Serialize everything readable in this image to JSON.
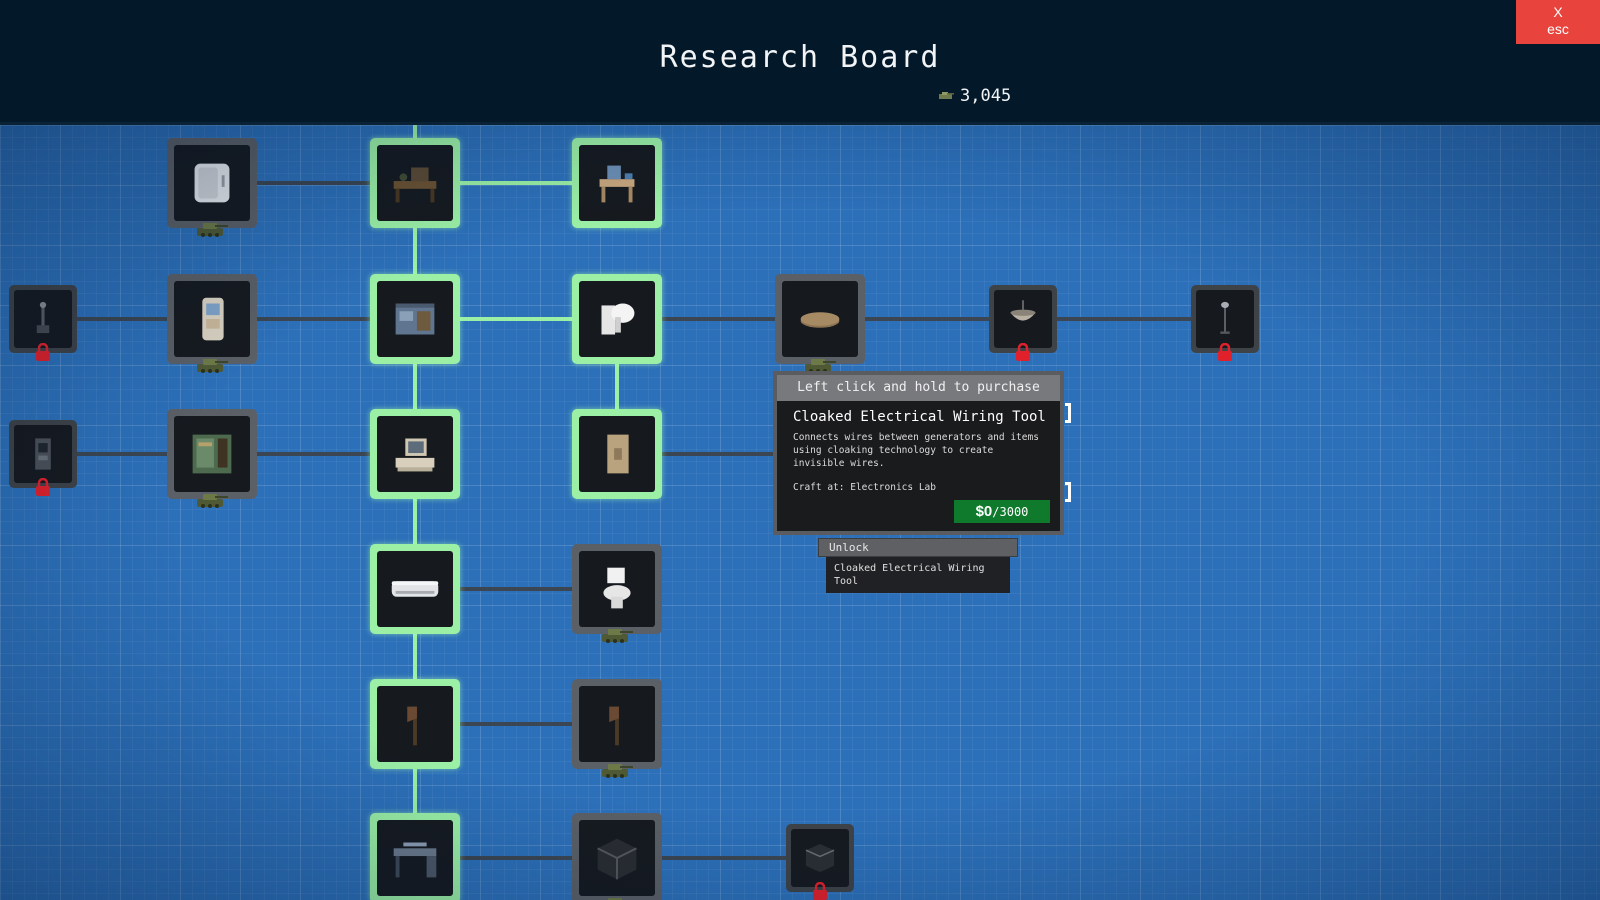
{
  "header": {
    "title": "Research Board",
    "currency_amount": "3,045",
    "close_label": "X",
    "close_hint": "esc"
  },
  "tooltip": {
    "hint": "Left click and hold to purchase",
    "item_name": "Cloaked Electrical Wiring Tool",
    "description": "Connects wires between generators and items using cloaking technology to create invisible wires.",
    "craft_at": "Craft at: Electronics Lab",
    "price_paid": "$0",
    "price_total": "/3000"
  },
  "unlock_panel": {
    "header": "Unlock",
    "item": "Cloaked Electrical Wiring Tool"
  },
  "nodes": [
    {
      "id": "fridge",
      "icon": "mini-fridge-icon",
      "state": "available"
    },
    {
      "id": "workbench",
      "icon": "workbench-icon",
      "state": "unlocked"
    },
    {
      "id": "desk",
      "icon": "small-desk-icon",
      "state": "unlocked"
    },
    {
      "id": "lamp-post-left",
      "icon": "lamp-post-icon",
      "state": "locked"
    },
    {
      "id": "arcade-machine",
      "icon": "arcade-machine-icon",
      "state": "available"
    },
    {
      "id": "generator",
      "icon": "generator-icon",
      "state": "unlocked"
    },
    {
      "id": "wall-sink",
      "icon": "wall-sink-icon",
      "state": "unlocked"
    },
    {
      "id": "round-table",
      "icon": "round-table-icon",
      "state": "available"
    },
    {
      "id": "chandelier",
      "icon": "chandelier-icon",
      "state": "locked"
    },
    {
      "id": "floor-lamp",
      "icon": "floor-lamp-icon",
      "state": "locked"
    },
    {
      "id": "arcade-cabinet",
      "icon": "arcade-cabinet-icon",
      "state": "locked"
    },
    {
      "id": "vending-machine",
      "icon": "vending-machine-icon",
      "state": "available"
    },
    {
      "id": "computer",
      "icon": "computer-icon",
      "state": "unlocked"
    },
    {
      "id": "light-switch",
      "icon": "light-switch-icon",
      "state": "unlocked"
    },
    {
      "id": "wall-heater",
      "icon": "wall-heater-icon",
      "state": "unlocked"
    },
    {
      "id": "toilet",
      "icon": "toilet-icon",
      "state": "available"
    },
    {
      "id": "axe-owned",
      "icon": "axe-icon",
      "state": "unlocked"
    },
    {
      "id": "axe-upgrade",
      "icon": "axe-icon",
      "state": "available"
    },
    {
      "id": "work-table",
      "icon": "work-table-icon",
      "state": "unlocked"
    },
    {
      "id": "metal-crate",
      "icon": "metal-crate-icon",
      "state": "available"
    },
    {
      "id": "dark-crate",
      "icon": "dark-crate-icon",
      "state": "locked"
    }
  ],
  "colors": {
    "board_blue": "#2c70b9",
    "unlocked_border": "#9bf0a6",
    "available_border": "#5b6066",
    "close_red": "#e8433c",
    "price_green": "#0f7a2c",
    "lock_red": "#e0212b"
  }
}
